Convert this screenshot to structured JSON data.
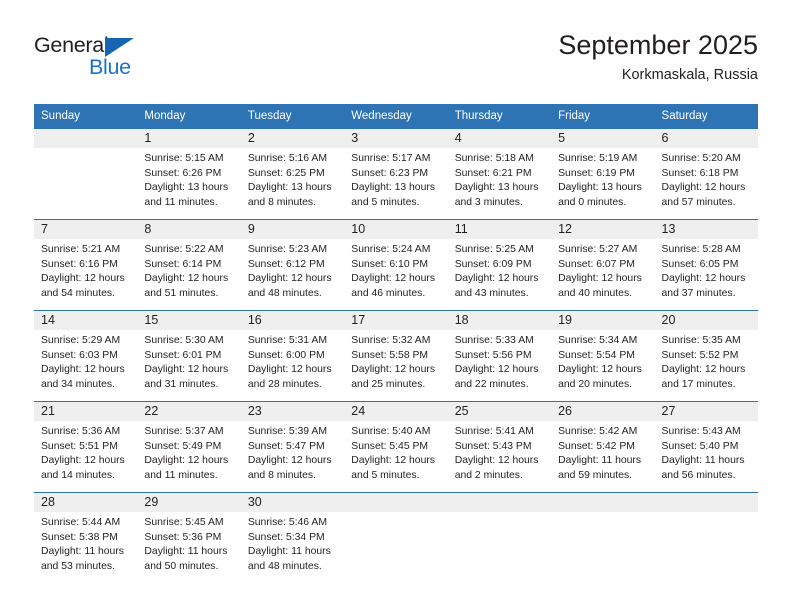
{
  "brand": {
    "name_part1": "General",
    "name_part2": "Blue",
    "triangle_color": "#1565b0",
    "blue_text_color": "#1a74c4"
  },
  "header": {
    "title": "September 2025",
    "subtitle": "Korkmaskala, Russia"
  },
  "theme": {
    "header_blue": "#2e74b5",
    "daynum_band": "#efefef",
    "text": "#231f20"
  },
  "calendar": {
    "weekdays": [
      "Sunday",
      "Monday",
      "Tuesday",
      "Wednesday",
      "Thursday",
      "Friday",
      "Saturday"
    ],
    "weeks": [
      [
        {
          "day": "",
          "sunrise": "",
          "sunset": "",
          "daylight_line1": "",
          "daylight_line2": ""
        },
        {
          "day": "1",
          "sunrise": "Sunrise: 5:15 AM",
          "sunset": "Sunset: 6:26 PM",
          "daylight_line1": "Daylight: 13 hours",
          "daylight_line2": "and 11 minutes."
        },
        {
          "day": "2",
          "sunrise": "Sunrise: 5:16 AM",
          "sunset": "Sunset: 6:25 PM",
          "daylight_line1": "Daylight: 13 hours",
          "daylight_line2": "and 8 minutes."
        },
        {
          "day": "3",
          "sunrise": "Sunrise: 5:17 AM",
          "sunset": "Sunset: 6:23 PM",
          "daylight_line1": "Daylight: 13 hours",
          "daylight_line2": "and 5 minutes."
        },
        {
          "day": "4",
          "sunrise": "Sunrise: 5:18 AM",
          "sunset": "Sunset: 6:21 PM",
          "daylight_line1": "Daylight: 13 hours",
          "daylight_line2": "and 3 minutes."
        },
        {
          "day": "5",
          "sunrise": "Sunrise: 5:19 AM",
          "sunset": "Sunset: 6:19 PM",
          "daylight_line1": "Daylight: 13 hours",
          "daylight_line2": "and 0 minutes."
        },
        {
          "day": "6",
          "sunrise": "Sunrise: 5:20 AM",
          "sunset": "Sunset: 6:18 PM",
          "daylight_line1": "Daylight: 12 hours",
          "daylight_line2": "and 57 minutes."
        }
      ],
      [
        {
          "day": "7",
          "sunrise": "Sunrise: 5:21 AM",
          "sunset": "Sunset: 6:16 PM",
          "daylight_line1": "Daylight: 12 hours",
          "daylight_line2": "and 54 minutes."
        },
        {
          "day": "8",
          "sunrise": "Sunrise: 5:22 AM",
          "sunset": "Sunset: 6:14 PM",
          "daylight_line1": "Daylight: 12 hours",
          "daylight_line2": "and 51 minutes."
        },
        {
          "day": "9",
          "sunrise": "Sunrise: 5:23 AM",
          "sunset": "Sunset: 6:12 PM",
          "daylight_line1": "Daylight: 12 hours",
          "daylight_line2": "and 48 minutes."
        },
        {
          "day": "10",
          "sunrise": "Sunrise: 5:24 AM",
          "sunset": "Sunset: 6:10 PM",
          "daylight_line1": "Daylight: 12 hours",
          "daylight_line2": "and 46 minutes."
        },
        {
          "day": "11",
          "sunrise": "Sunrise: 5:25 AM",
          "sunset": "Sunset: 6:09 PM",
          "daylight_line1": "Daylight: 12 hours",
          "daylight_line2": "and 43 minutes."
        },
        {
          "day": "12",
          "sunrise": "Sunrise: 5:27 AM",
          "sunset": "Sunset: 6:07 PM",
          "daylight_line1": "Daylight: 12 hours",
          "daylight_line2": "and 40 minutes."
        },
        {
          "day": "13",
          "sunrise": "Sunrise: 5:28 AM",
          "sunset": "Sunset: 6:05 PM",
          "daylight_line1": "Daylight: 12 hours",
          "daylight_line2": "and 37 minutes."
        }
      ],
      [
        {
          "day": "14",
          "sunrise": "Sunrise: 5:29 AM",
          "sunset": "Sunset: 6:03 PM",
          "daylight_line1": "Daylight: 12 hours",
          "daylight_line2": "and 34 minutes."
        },
        {
          "day": "15",
          "sunrise": "Sunrise: 5:30 AM",
          "sunset": "Sunset: 6:01 PM",
          "daylight_line1": "Daylight: 12 hours",
          "daylight_line2": "and 31 minutes."
        },
        {
          "day": "16",
          "sunrise": "Sunrise: 5:31 AM",
          "sunset": "Sunset: 6:00 PM",
          "daylight_line1": "Daylight: 12 hours",
          "daylight_line2": "and 28 minutes."
        },
        {
          "day": "17",
          "sunrise": "Sunrise: 5:32 AM",
          "sunset": "Sunset: 5:58 PM",
          "daylight_line1": "Daylight: 12 hours",
          "daylight_line2": "and 25 minutes."
        },
        {
          "day": "18",
          "sunrise": "Sunrise: 5:33 AM",
          "sunset": "Sunset: 5:56 PM",
          "daylight_line1": "Daylight: 12 hours",
          "daylight_line2": "and 22 minutes."
        },
        {
          "day": "19",
          "sunrise": "Sunrise: 5:34 AM",
          "sunset": "Sunset: 5:54 PM",
          "daylight_line1": "Daylight: 12 hours",
          "daylight_line2": "and 20 minutes."
        },
        {
          "day": "20",
          "sunrise": "Sunrise: 5:35 AM",
          "sunset": "Sunset: 5:52 PM",
          "daylight_line1": "Daylight: 12 hours",
          "daylight_line2": "and 17 minutes."
        }
      ],
      [
        {
          "day": "21",
          "sunrise": "Sunrise: 5:36 AM",
          "sunset": "Sunset: 5:51 PM",
          "daylight_line1": "Daylight: 12 hours",
          "daylight_line2": "and 14 minutes."
        },
        {
          "day": "22",
          "sunrise": "Sunrise: 5:37 AM",
          "sunset": "Sunset: 5:49 PM",
          "daylight_line1": "Daylight: 12 hours",
          "daylight_line2": "and 11 minutes."
        },
        {
          "day": "23",
          "sunrise": "Sunrise: 5:39 AM",
          "sunset": "Sunset: 5:47 PM",
          "daylight_line1": "Daylight: 12 hours",
          "daylight_line2": "and 8 minutes."
        },
        {
          "day": "24",
          "sunrise": "Sunrise: 5:40 AM",
          "sunset": "Sunset: 5:45 PM",
          "daylight_line1": "Daylight: 12 hours",
          "daylight_line2": "and 5 minutes."
        },
        {
          "day": "25",
          "sunrise": "Sunrise: 5:41 AM",
          "sunset": "Sunset: 5:43 PM",
          "daylight_line1": "Daylight: 12 hours",
          "daylight_line2": "and 2 minutes."
        },
        {
          "day": "26",
          "sunrise": "Sunrise: 5:42 AM",
          "sunset": "Sunset: 5:42 PM",
          "daylight_line1": "Daylight: 11 hours",
          "daylight_line2": "and 59 minutes."
        },
        {
          "day": "27",
          "sunrise": "Sunrise: 5:43 AM",
          "sunset": "Sunset: 5:40 PM",
          "daylight_line1": "Daylight: 11 hours",
          "daylight_line2": "and 56 minutes."
        }
      ],
      [
        {
          "day": "28",
          "sunrise": "Sunrise: 5:44 AM",
          "sunset": "Sunset: 5:38 PM",
          "daylight_line1": "Daylight: 11 hours",
          "daylight_line2": "and 53 minutes."
        },
        {
          "day": "29",
          "sunrise": "Sunrise: 5:45 AM",
          "sunset": "Sunset: 5:36 PM",
          "daylight_line1": "Daylight: 11 hours",
          "daylight_line2": "and 50 minutes."
        },
        {
          "day": "30",
          "sunrise": "Sunrise: 5:46 AM",
          "sunset": "Sunset: 5:34 PM",
          "daylight_line1": "Daylight: 11 hours",
          "daylight_line2": "and 48 minutes."
        },
        {
          "day": "",
          "sunrise": "",
          "sunset": "",
          "daylight_line1": "",
          "daylight_line2": ""
        },
        {
          "day": "",
          "sunrise": "",
          "sunset": "",
          "daylight_line1": "",
          "daylight_line2": ""
        },
        {
          "day": "",
          "sunrise": "",
          "sunset": "",
          "daylight_line1": "",
          "daylight_line2": ""
        },
        {
          "day": "",
          "sunrise": "",
          "sunset": "",
          "daylight_line1": "",
          "daylight_line2": ""
        }
      ]
    ]
  }
}
